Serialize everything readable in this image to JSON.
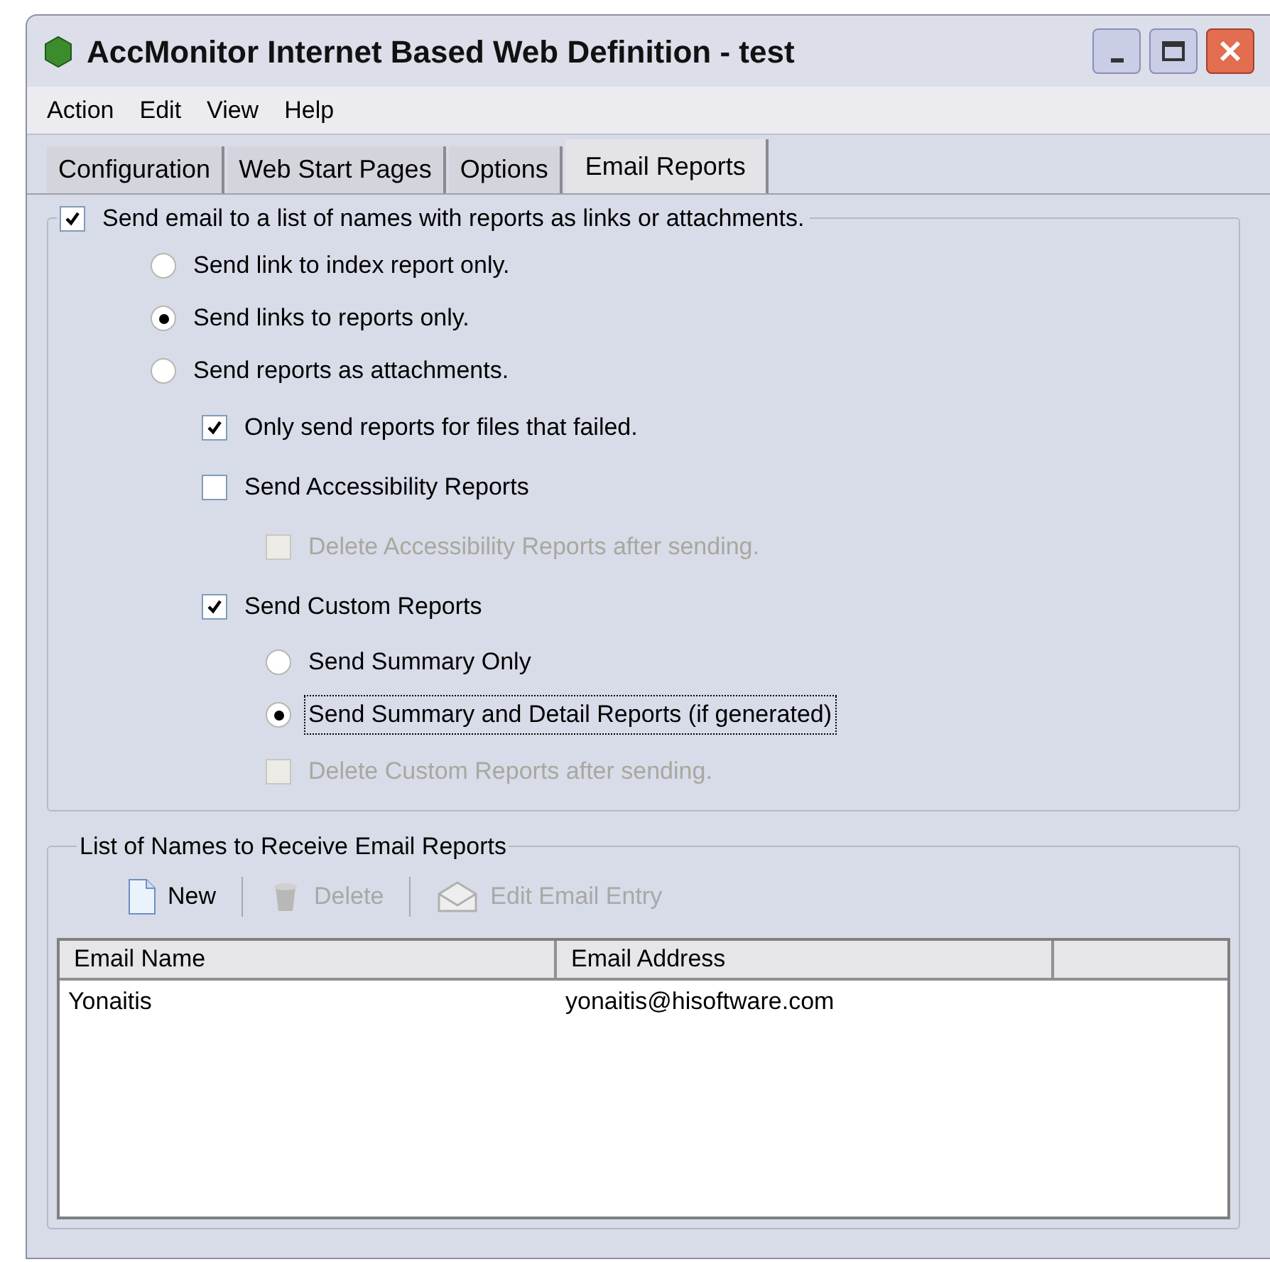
{
  "window": {
    "title": "AccMonitor Internet Based Web Definition - test"
  },
  "menu": [
    "Action",
    "Edit",
    "View",
    "Help"
  ],
  "tabs": [
    {
      "label": "Configuration",
      "selected": false
    },
    {
      "label": "Web Start Pages",
      "selected": false
    },
    {
      "label": "Options",
      "selected": false
    },
    {
      "label": "Email Reports",
      "selected": true
    }
  ],
  "main_option": {
    "label": "Send email to a list of names with reports as links or attachments.",
    "checked": true
  },
  "delivery_options": [
    {
      "label": "Send link to index report only.",
      "selected": false
    },
    {
      "label": "Send links to reports only.",
      "selected": true
    },
    {
      "label": "Send reports as attachments.",
      "selected": false
    }
  ],
  "report_options": [
    {
      "kind": "checkbox",
      "label": "Only send reports for files that failed.",
      "checked": true,
      "disabled": false,
      "focused": false
    },
    {
      "kind": "checkbox",
      "label": "Send Accessibility Reports",
      "checked": false,
      "disabled": false,
      "focused": false,
      "children": [
        {
          "kind": "checkbox",
          "label": "Delete Accessibility Reports after sending.",
          "checked": false,
          "disabled": true,
          "focused": false
        }
      ]
    },
    {
      "kind": "checkbox",
      "label": "Send Custom Reports",
      "checked": true,
      "disabled": false,
      "focused": false,
      "children": [
        {
          "kind": "radio",
          "label": "Send Summary Only",
          "selected": false,
          "disabled": false,
          "focused": false
        },
        {
          "kind": "radio",
          "label": "Send Summary and Detail Reports (if generated)",
          "selected": true,
          "disabled": false,
          "focused": true
        },
        {
          "kind": "checkbox",
          "label": "Delete Custom Reports after sending.",
          "checked": false,
          "disabled": true,
          "focused": false
        }
      ]
    }
  ],
  "recipients": {
    "title": "List of Names to Receive Email Reports",
    "toolbar": [
      {
        "kind": "new",
        "label": "New",
        "disabled": false
      },
      {
        "kind": "delete",
        "label": "Delete",
        "disabled": true
      },
      {
        "kind": "edit",
        "label": "Edit Email Entry",
        "disabled": true
      }
    ],
    "columns": [
      "Email Name",
      "Email Address"
    ],
    "rows": [
      [
        "Yonaitis",
        "yonaitis@hisoftware.com"
      ]
    ]
  }
}
